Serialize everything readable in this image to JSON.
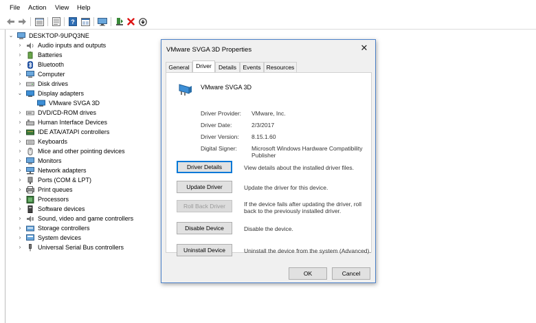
{
  "menu": [
    "File",
    "Action",
    "View",
    "Help"
  ],
  "toolbar": {
    "icons": [
      "back-arrow-icon",
      "forward-arrow-icon",
      "show-hide-tree-icon",
      "properties-icon",
      "help-icon",
      "view-icon",
      "monitor-icon",
      "update-driver-icon",
      "uninstall-icon",
      "disable-icon"
    ]
  },
  "tree": {
    "root": "DESKTOP-9UPQ3NE",
    "items": [
      {
        "label": "Audio inputs and outputs",
        "icon": "speaker-icon"
      },
      {
        "label": "Batteries",
        "icon": "battery-icon"
      },
      {
        "label": "Bluetooth",
        "icon": "bluetooth-icon"
      },
      {
        "label": "Computer",
        "icon": "computer-icon"
      },
      {
        "label": "Disk drives",
        "icon": "disk-drive-icon"
      },
      {
        "label": "Display adapters",
        "icon": "display-adapter-icon",
        "expanded": true
      },
      {
        "label": "VMware SVGA 3D",
        "icon": "display-adapter-icon",
        "child": true
      },
      {
        "label": "DVD/CD-ROM drives",
        "icon": "dvd-icon"
      },
      {
        "label": "Human Interface Devices",
        "icon": "hid-icon"
      },
      {
        "label": "IDE ATA/ATAPI controllers",
        "icon": "ide-icon"
      },
      {
        "label": "Keyboards",
        "icon": "keyboard-icon"
      },
      {
        "label": "Mice and other pointing devices",
        "icon": "mouse-icon"
      },
      {
        "label": "Monitors",
        "icon": "monitor-icon"
      },
      {
        "label": "Network adapters",
        "icon": "network-icon"
      },
      {
        "label": "Ports (COM & LPT)",
        "icon": "port-icon"
      },
      {
        "label": "Print queues",
        "icon": "printer-icon"
      },
      {
        "label": "Processors",
        "icon": "processor-icon"
      },
      {
        "label": "Software devices",
        "icon": "software-device-icon"
      },
      {
        "label": "Sound, video and game controllers",
        "icon": "sound-icon"
      },
      {
        "label": "Storage controllers",
        "icon": "storage-icon"
      },
      {
        "label": "System devices",
        "icon": "system-icon"
      },
      {
        "label": "Universal Serial Bus controllers",
        "icon": "usb-icon"
      }
    ]
  },
  "dialog": {
    "title": "VMware SVGA 3D Properties",
    "tabs": [
      "General",
      "Driver",
      "Details",
      "Events",
      "Resources"
    ],
    "active_tab": "Driver",
    "device_name": "VMware SVGA 3D",
    "props": [
      {
        "label": "Driver Provider:",
        "value": "VMware, Inc."
      },
      {
        "label": "Driver Date:",
        "value": "2/3/2017"
      },
      {
        "label": "Driver Version:",
        "value": "8.15.1.60"
      },
      {
        "label": "Digital Signer:",
        "value": "Microsoft Windows Hardware Compatibility Publisher"
      }
    ],
    "actions": [
      {
        "label": "Driver Details",
        "desc": "View details about the installed driver files.",
        "enabled": true
      },
      {
        "label": "Update Driver",
        "desc": "Update the driver for this device.",
        "enabled": true
      },
      {
        "label": "Roll Back Driver",
        "desc": "If the device fails after updating the driver, roll back to the previously installed driver.",
        "enabled": false
      },
      {
        "label": "Disable Device",
        "desc": "Disable the device.",
        "enabled": true
      },
      {
        "label": "Uninstall Device",
        "desc": "Uninstall the device from the system (Advanced).",
        "enabled": true
      }
    ],
    "ok_label": "OK",
    "cancel_label": "Cancel"
  }
}
